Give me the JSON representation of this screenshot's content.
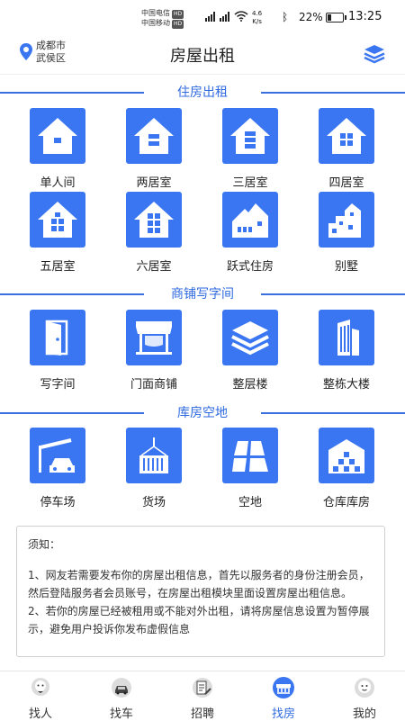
{
  "status_bar": {
    "carrier1": "中国电信",
    "carrier2": "中国移动",
    "hd": "HD",
    "speed_value": "4.6",
    "speed_unit": "K/s",
    "battery": "22%",
    "battery_level": 0.22,
    "time": "13:25"
  },
  "header": {
    "city": "成都市",
    "district": "武侯区",
    "title": "房屋出租"
  },
  "sections": [
    {
      "title": "住房出租",
      "items": [
        {
          "label": "单人间",
          "icon": "house-1-icon"
        },
        {
          "label": "两居室",
          "icon": "house-2-icon"
        },
        {
          "label": "三居室",
          "icon": "house-3-icon"
        },
        {
          "label": "四居室",
          "icon": "house-4-icon"
        },
        {
          "label": "五居室",
          "icon": "house-5-icon"
        },
        {
          "label": "六居室",
          "icon": "house-6-icon"
        },
        {
          "label": "跃式住房",
          "icon": "duplex-icon"
        },
        {
          "label": "别墅",
          "icon": "villa-icon"
        }
      ]
    },
    {
      "title": "商铺写字间",
      "items": [
        {
          "label": "写字间",
          "icon": "office-door-icon"
        },
        {
          "label": "门面商铺",
          "icon": "storefront-icon"
        },
        {
          "label": "整层楼",
          "icon": "layers-icon"
        },
        {
          "label": "整栋大楼",
          "icon": "building-icon"
        }
      ]
    },
    {
      "title": "库房空地",
      "items": [
        {
          "label": "停车场",
          "icon": "parking-icon"
        },
        {
          "label": "货场",
          "icon": "cargo-container-icon"
        },
        {
          "label": "空地",
          "icon": "vacant-lot-icon"
        },
        {
          "label": "仓库库房",
          "icon": "warehouse-icon"
        }
      ]
    }
  ],
  "notice": {
    "title": "须知：",
    "p1": "1、网友若需要发布你的房屋出租信息，首先以服务者的身份注册会员，然后登陆服务者会员账号，在房屋出租模块里面设置房屋出租信息。",
    "p2": "2、若你的房屋已经被租用或不能对外出租，请将房屋信息设置为暂停展示，避免用户投诉你发布虚假信息"
  },
  "tabs": [
    {
      "label": "找人",
      "icon": "person-tab-icon"
    },
    {
      "label": "找车",
      "icon": "car-tab-icon"
    },
    {
      "label": "招聘",
      "icon": "recruit-tab-icon"
    },
    {
      "label": "找房",
      "icon": "house-tab-icon",
      "active": true
    },
    {
      "label": "我的",
      "icon": "profile-tab-icon"
    }
  ],
  "colors": {
    "accent": "#3b76f2",
    "section_title": "#2f6ae0"
  }
}
